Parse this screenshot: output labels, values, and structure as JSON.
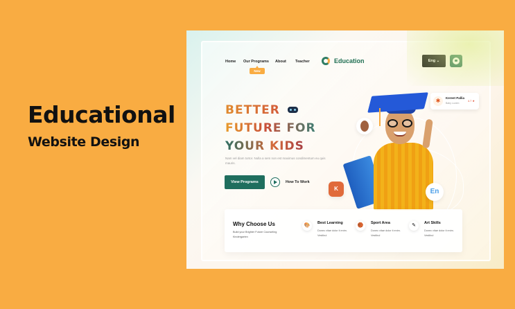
{
  "promo": {
    "title": "Educational",
    "subtitle": "Website Design"
  },
  "nav": {
    "items": [
      {
        "label": "Home"
      },
      {
        "label": "Our Programs"
      },
      {
        "label": "About"
      },
      {
        "label": "Teacher"
      }
    ],
    "new_badge": "New",
    "logo_text": "Education",
    "language": "Eng ⌄"
  },
  "hero": {
    "lines": [
      "BETTER",
      "FUTURE FOR",
      "YOUR KIDS"
    ],
    "description": "Nam vel diam tortor. Nulla a sem non est maximus condimentum eu quis mauris.",
    "cta": "View Programs",
    "secondary": "How To Work"
  },
  "review": {
    "name": "Kereet Pallia",
    "role": "Baby Lovem",
    "rating": "4.7 ★"
  },
  "bubbles": {
    "app_label": "K",
    "lang_label": "En"
  },
  "why": {
    "title": "Why Choose Us",
    "description": "Build your Brighter Future Counseling Kindergarten",
    "features": [
      {
        "icon": "🎨",
        "title": "Best Learning",
        "text": "Donec vitae dolor it enim. Vestibul"
      },
      {
        "icon": "🏀",
        "title": "Sport Area",
        "text": "Donec vitae dolor it enim. Vestibul"
      },
      {
        "icon": "✎",
        "title": "Art Skills",
        "text": "Donec vitae dolor it enim. Vestibul"
      }
    ]
  },
  "colors": {
    "background": "#F9AC42",
    "primary": "#1f6e5e",
    "dark": "#141414"
  }
}
